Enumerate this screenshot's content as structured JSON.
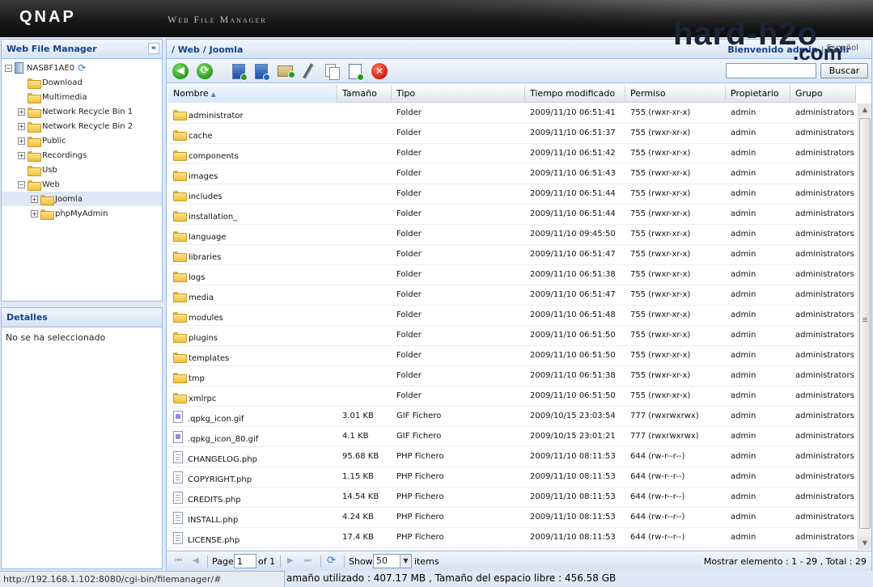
{
  "header": {
    "logo": "QNAP",
    "app_name": "Web File Manager"
  },
  "watermark": {
    "line1": "hard-h2o",
    "line2": ".com"
  },
  "left": {
    "tree_title": "Web File Manager",
    "collapse_icon": "«",
    "tree": [
      {
        "label": "NASBF1AE0",
        "level": 0,
        "expander": "−",
        "type": "server"
      },
      {
        "label": "Download",
        "level": 1,
        "expander": "",
        "type": "folder"
      },
      {
        "label": "Multimedia",
        "level": 1,
        "expander": "",
        "type": "folder"
      },
      {
        "label": "Network Recycle Bin 1",
        "level": 1,
        "expander": "+",
        "type": "folder"
      },
      {
        "label": "Network Recycle Bin 2",
        "level": 1,
        "expander": "+",
        "type": "folder"
      },
      {
        "label": "Public",
        "level": 1,
        "expander": "+",
        "type": "folder"
      },
      {
        "label": "Recordings",
        "level": 1,
        "expander": "+",
        "type": "folder"
      },
      {
        "label": "Usb",
        "level": 1,
        "expander": "",
        "type": "folder"
      },
      {
        "label": "Web",
        "level": 1,
        "expander": "−",
        "type": "folder"
      },
      {
        "label": "Joomla",
        "level": 2,
        "expander": "+",
        "type": "folder",
        "selected": true
      },
      {
        "label": "phpMyAdmin",
        "level": 2,
        "expander": "+",
        "type": "folder"
      }
    ],
    "details_title": "Detalles",
    "details_text": "No se ha seleccionado"
  },
  "main": {
    "breadcrumb": "/ Web / Joomla",
    "welcome": "Bienvenido admin",
    "logout": "Salir",
    "language": "Español",
    "search": {
      "value": "",
      "button": "Buscar"
    },
    "columns": [
      "Nombre",
      "Tamaño",
      "Tipo",
      "Tiempo modificado",
      "Permiso",
      "Propietario",
      "Grupo"
    ],
    "rows": [
      {
        "name": "administrator",
        "size": "",
        "type": "Folder",
        "modified": "2009/11/10 06:51:41",
        "perm": "755 (rwxr-xr-x)",
        "owner": "admin",
        "group": "administrators",
        "icon": "folder"
      },
      {
        "name": "cache",
        "size": "",
        "type": "Folder",
        "modified": "2009/11/10 06:51:37",
        "perm": "755 (rwxr-xr-x)",
        "owner": "admin",
        "group": "administrators",
        "icon": "folder"
      },
      {
        "name": "components",
        "size": "",
        "type": "Folder",
        "modified": "2009/11/10 06:51:42",
        "perm": "755 (rwxr-xr-x)",
        "owner": "admin",
        "group": "administrators",
        "icon": "folder"
      },
      {
        "name": "images",
        "size": "",
        "type": "Folder",
        "modified": "2009/11/10 06:51:43",
        "perm": "755 (rwxr-xr-x)",
        "owner": "admin",
        "group": "administrators",
        "icon": "folder"
      },
      {
        "name": "includes",
        "size": "",
        "type": "Folder",
        "modified": "2009/11/10 06:51:44",
        "perm": "755 (rwxr-xr-x)",
        "owner": "admin",
        "group": "administrators",
        "icon": "folder"
      },
      {
        "name": "installation_",
        "size": "",
        "type": "Folder",
        "modified": "2009/11/10 06:51:44",
        "perm": "755 (rwxr-xr-x)",
        "owner": "admin",
        "group": "administrators",
        "icon": "folder"
      },
      {
        "name": "language",
        "size": "",
        "type": "Folder",
        "modified": "2009/11/10 09:45:50",
        "perm": "755 (rwxr-xr-x)",
        "owner": "admin",
        "group": "administrators",
        "icon": "folder"
      },
      {
        "name": "libraries",
        "size": "",
        "type": "Folder",
        "modified": "2009/11/10 06:51:47",
        "perm": "755 (rwxr-xr-x)",
        "owner": "admin",
        "group": "administrators",
        "icon": "folder"
      },
      {
        "name": "logs",
        "size": "",
        "type": "Folder",
        "modified": "2009/11/10 06:51:38",
        "perm": "755 (rwxr-xr-x)",
        "owner": "admin",
        "group": "administrators",
        "icon": "folder"
      },
      {
        "name": "media",
        "size": "",
        "type": "Folder",
        "modified": "2009/11/10 06:51:47",
        "perm": "755 (rwxr-xr-x)",
        "owner": "admin",
        "group": "administrators",
        "icon": "folder"
      },
      {
        "name": "modules",
        "size": "",
        "type": "Folder",
        "modified": "2009/11/10 06:51:48",
        "perm": "755 (rwxr-xr-x)",
        "owner": "admin",
        "group": "administrators",
        "icon": "folder"
      },
      {
        "name": "plugins",
        "size": "",
        "type": "Folder",
        "modified": "2009/11/10 06:51:50",
        "perm": "755 (rwxr-xr-x)",
        "owner": "admin",
        "group": "administrators",
        "icon": "folder"
      },
      {
        "name": "templates",
        "size": "",
        "type": "Folder",
        "modified": "2009/11/10 06:51:50",
        "perm": "755 (rwxr-xr-x)",
        "owner": "admin",
        "group": "administrators",
        "icon": "folder"
      },
      {
        "name": "tmp",
        "size": "",
        "type": "Folder",
        "modified": "2009/11/10 06:51:38",
        "perm": "755 (rwxr-xr-x)",
        "owner": "admin",
        "group": "administrators",
        "icon": "folder"
      },
      {
        "name": "xmlrpc",
        "size": "",
        "type": "Folder",
        "modified": "2009/11/10 06:51:50",
        "perm": "755 (rwxr-xr-x)",
        "owner": "admin",
        "group": "administrators",
        "icon": "folder"
      },
      {
        "name": ".qpkg_icon.gif",
        "size": "3.01 KB",
        "type": "GIF Fichero",
        "modified": "2009/10/15 23:03:54",
        "perm": "777 (rwxrwxrwx)",
        "owner": "admin",
        "group": "administrators",
        "icon": "gif"
      },
      {
        "name": ".qpkg_icon_80.gif",
        "size": "4.1 KB",
        "type": "GIF Fichero",
        "modified": "2009/10/15 23:01:21",
        "perm": "777 (rwxrwxrwx)",
        "owner": "admin",
        "group": "administrators",
        "icon": "gif"
      },
      {
        "name": "CHANGELOG.php",
        "size": "95.68 KB",
        "type": "PHP Fichero",
        "modified": "2009/11/10 08:11:53",
        "perm": "644 (rw-r--r--)",
        "owner": "admin",
        "group": "administrators",
        "icon": "php"
      },
      {
        "name": "COPYRIGHT.php",
        "size": "1.15 KB",
        "type": "PHP Fichero",
        "modified": "2009/11/10 08:11:53",
        "perm": "644 (rw-r--r--)",
        "owner": "admin",
        "group": "administrators",
        "icon": "php"
      },
      {
        "name": "CREDITS.php",
        "size": "14.54 KB",
        "type": "PHP Fichero",
        "modified": "2009/11/10 08:11:53",
        "perm": "644 (rw-r--r--)",
        "owner": "admin",
        "group": "administrators",
        "icon": "php"
      },
      {
        "name": "INSTALL.php",
        "size": "4.24 KB",
        "type": "PHP Fichero",
        "modified": "2009/11/10 08:11:53",
        "perm": "644 (rw-r--r--)",
        "owner": "admin",
        "group": "administrators",
        "icon": "php"
      },
      {
        "name": "LICENSE.php",
        "size": "17.4 KB",
        "type": "PHP Fichero",
        "modified": "2009/11/10 08:11:53",
        "perm": "644 (rw-r--r--)",
        "owner": "admin",
        "group": "administrators",
        "icon": "php"
      }
    ],
    "pager": {
      "page_label": "Page",
      "page_value": "1",
      "of_label": "of 1",
      "show_label": "Show",
      "show_value": "50",
      "items_label": "items",
      "display_text": "Mostrar elemento : 1 - 29 , Total : 29"
    }
  },
  "status": {
    "url": "http://192.168.1.102:8080/cgi-bin/filemanager/#",
    "usage": "amaño utilizado : 407.17 MB , Tamaño del espacio libre : 456.58 GB"
  },
  "colors": {
    "panel_border": "#99bbe8",
    "panel_title": "#15428b",
    "header_bg": "#1a1a1a"
  }
}
